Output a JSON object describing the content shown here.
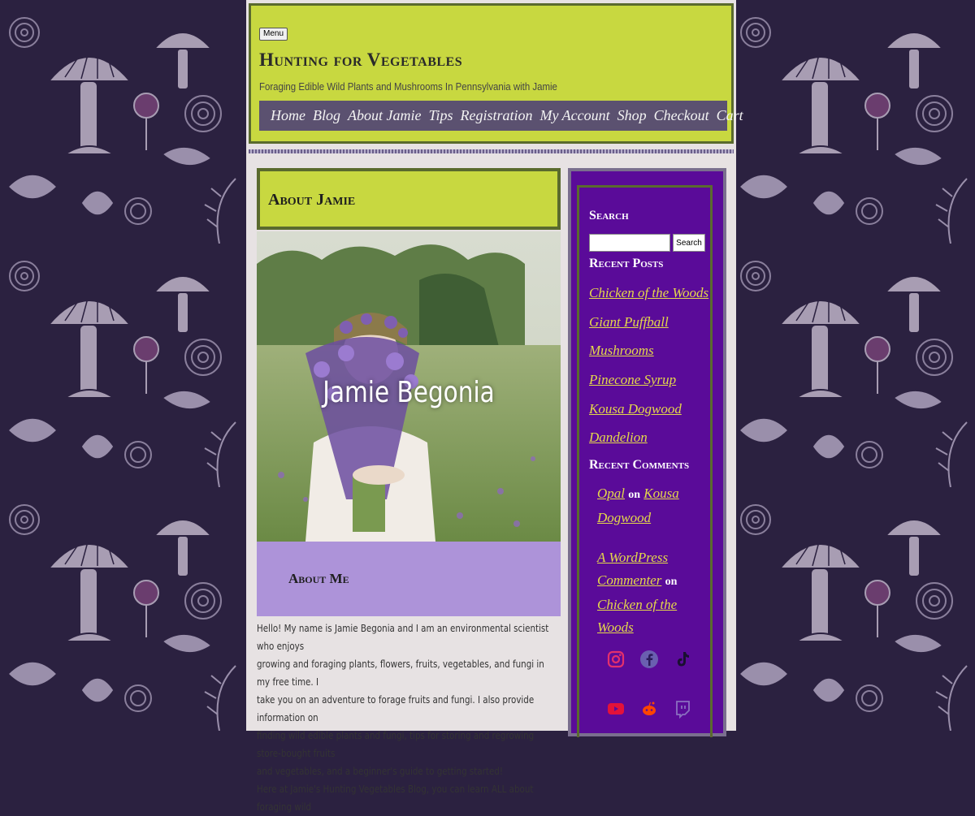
{
  "header": {
    "menu_label": "Menu",
    "site_title": "Hunting for Vegetables",
    "tagline": "Foraging Edible Wild Plants and Mushrooms In Pennsylvania with Jamie",
    "nav": [
      "Home",
      "Blog",
      "About Jamie",
      "Tips",
      "Registration",
      "My Account",
      "Shop",
      "Checkout",
      "Cart"
    ]
  },
  "article": {
    "title": "About Jamie",
    "hero_name": "Jamie Begonia",
    "about_heading": "About Me",
    "paragraphs": [
      "Hello! My name is Jamie Begonia and I am an environmental scientist who enjoys",
      "growing and foraging plants, flowers, fruits, vegetables, and fungi in my free time. I",
      "take you on an adventure to forage fruits and fungi. I also provide information on",
      "finding wild edible plants and fungi, tips for storing and regrowing store-bought fruits",
      "and vegetables, and a beginner's guide to getting started!",
      "Here at Jamie's Hunting Vegetables Blog, you can learn ALL about foraging wild"
    ]
  },
  "sidebar": {
    "search_title": "Search",
    "search_button": "Search",
    "search_value": "",
    "recent_posts_title": "Recent Posts",
    "recent_posts": [
      "Chicken of the Woods",
      "Giant Puffball",
      "Mushrooms",
      "Pinecone Syrup",
      "Kousa Dogwood",
      "Dandelion"
    ],
    "recent_comments_title": "Recent Comments",
    "comments": [
      {
        "author": "Opal",
        "on": "on",
        "post": "Kousa Dogwood"
      },
      {
        "author": "A WordPress Commenter",
        "on": "on",
        "post": "Chicken of the Woods"
      }
    ],
    "social_icons": [
      "instagram-icon",
      "facebook-icon",
      "tiktok-icon",
      "youtube-icon",
      "reddit-icon",
      "twitch-icon"
    ]
  },
  "colors": {
    "header_bg": "#c8d840",
    "nav_bg": "#5b5170",
    "sidebar_bg": "#5a0b99",
    "link": "#e4d84a",
    "about_box": "#ad93d9"
  }
}
